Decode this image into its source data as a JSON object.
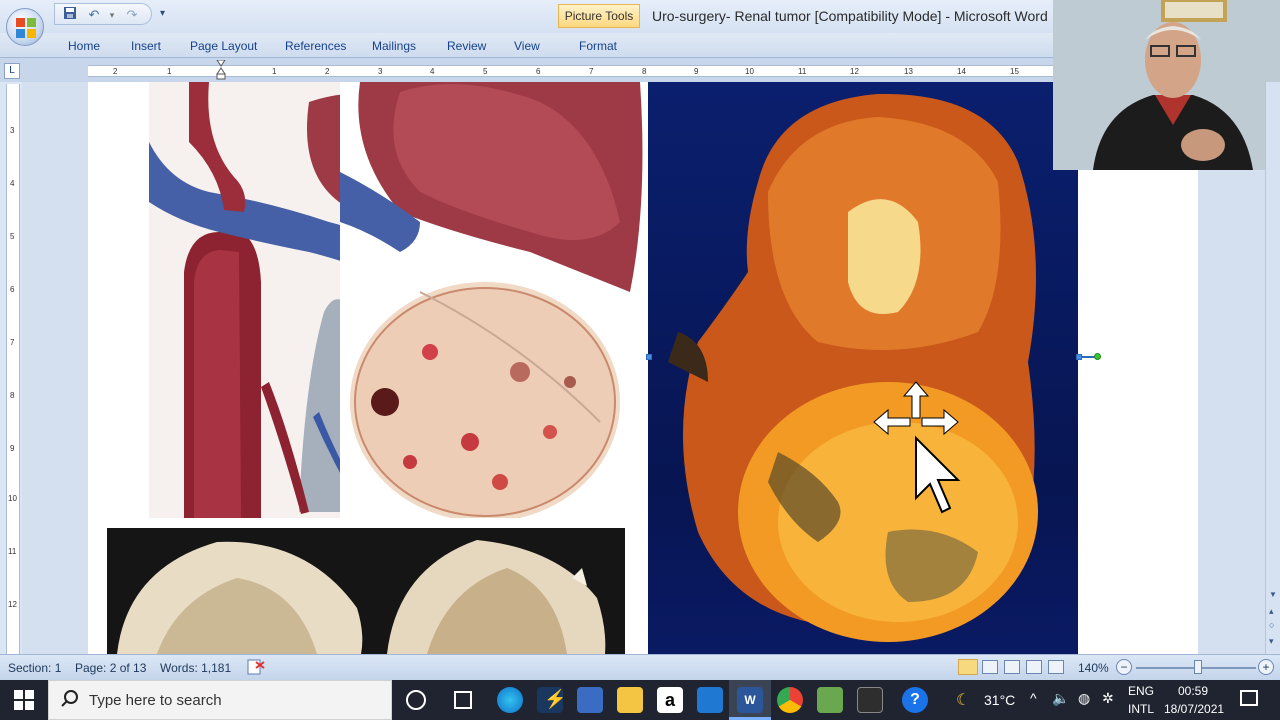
{
  "window": {
    "doc_title": "Uro-surgery- Renal tumor [Compatibility Mode] - Microsoft Word",
    "contextual_tab": "Picture Tools"
  },
  "ribbon": {
    "tabs": [
      "Home",
      "Insert",
      "Page Layout",
      "References",
      "Mailings",
      "Review",
      "View",
      "Format"
    ]
  },
  "ruler": {
    "corner_label": "L",
    "h_numbers": [
      "2",
      "1",
      "1",
      "2",
      "3",
      "4",
      "5",
      "6",
      "7",
      "8",
      "9",
      "10",
      "11",
      "12",
      "13",
      "14",
      "15"
    ],
    "v_numbers": [
      "3",
      "4",
      "5",
      "6",
      "7",
      "8",
      "9",
      "10",
      "11",
      "12"
    ]
  },
  "statusbar": {
    "section": "Section: 1",
    "page": "Page: 2 of 13",
    "words": "Words: 1,181",
    "zoom": "140%"
  },
  "taskbar": {
    "search_placeholder": "Type here to search",
    "weather": "31°C",
    "lang_top": "ENG",
    "lang_bottom": "INTL",
    "time": "00:59",
    "date": "18/07/2021"
  },
  "icons": {
    "office_button": "office-logo-icon",
    "save": "save-icon",
    "undo": "undo-icon",
    "redo": "redo-icon"
  },
  "colors": {
    "word_blue": "#15428b",
    "picture_tools": "#fcd77f",
    "taskbar": "#1f2430",
    "image_blue_bg": "#0a1f6e"
  }
}
